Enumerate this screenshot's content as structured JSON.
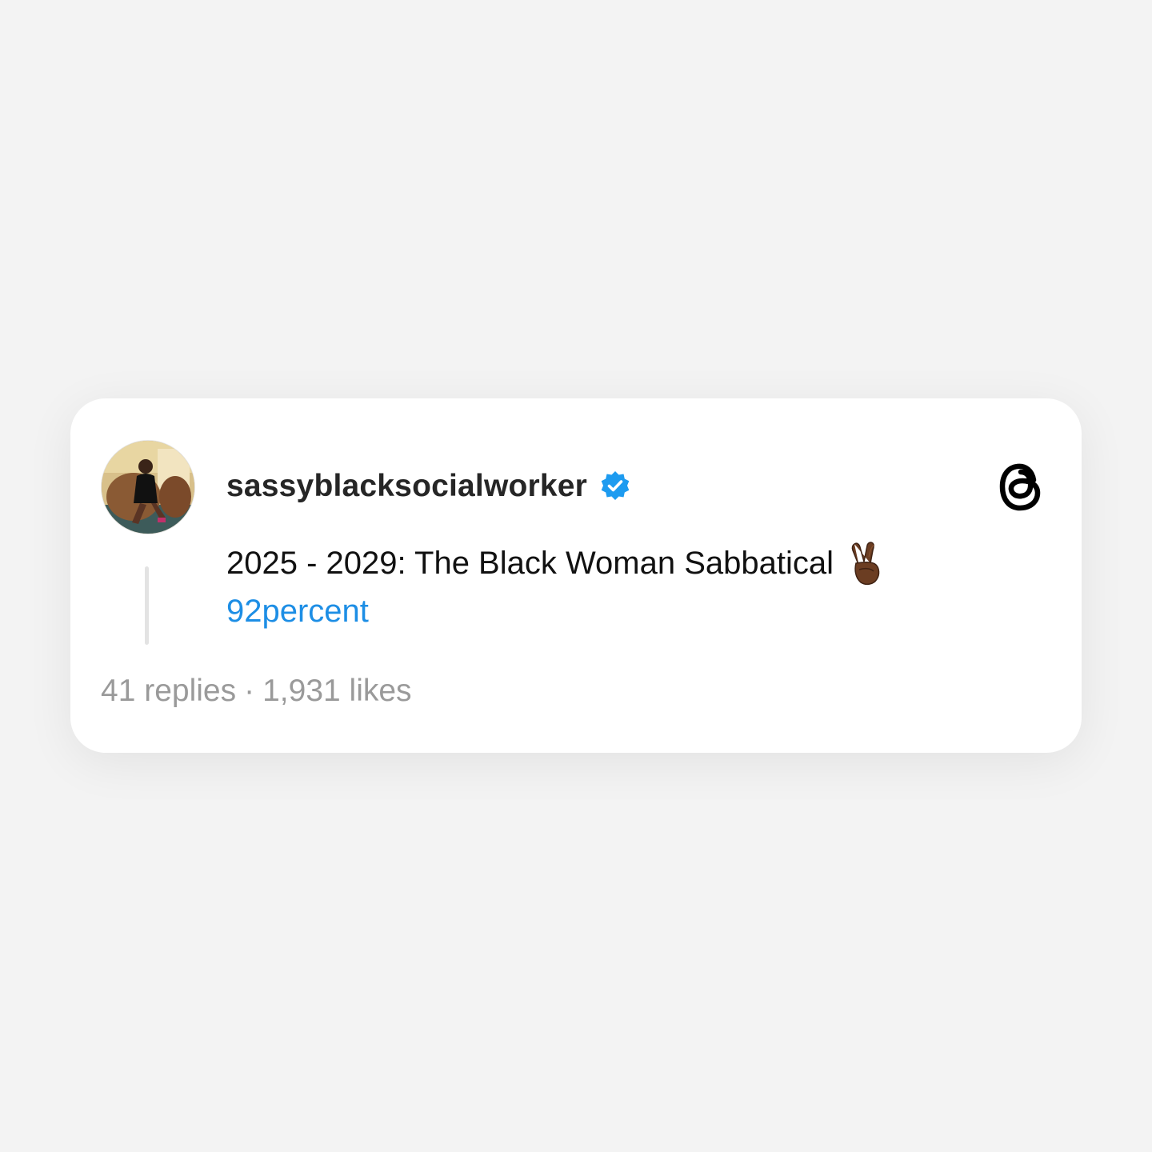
{
  "post": {
    "username": "sassyblacksocialworker",
    "verified": true,
    "text": "2025 - 2029: The Black Woman Sabbatical",
    "emoji": "victory-hand-dark-skin",
    "link_text": "92percent",
    "replies": "41 replies",
    "separator": "·",
    "likes": "1,931 likes"
  },
  "icons": {
    "verified": "verified-badge-icon",
    "brand": "threads-logo-icon"
  },
  "colors": {
    "background": "#f3f3f3",
    "card": "#ffffff",
    "username": "#262626",
    "link": "#1d8ee5",
    "verified": "#1d9bf0",
    "muted": "#9a9a9a"
  }
}
